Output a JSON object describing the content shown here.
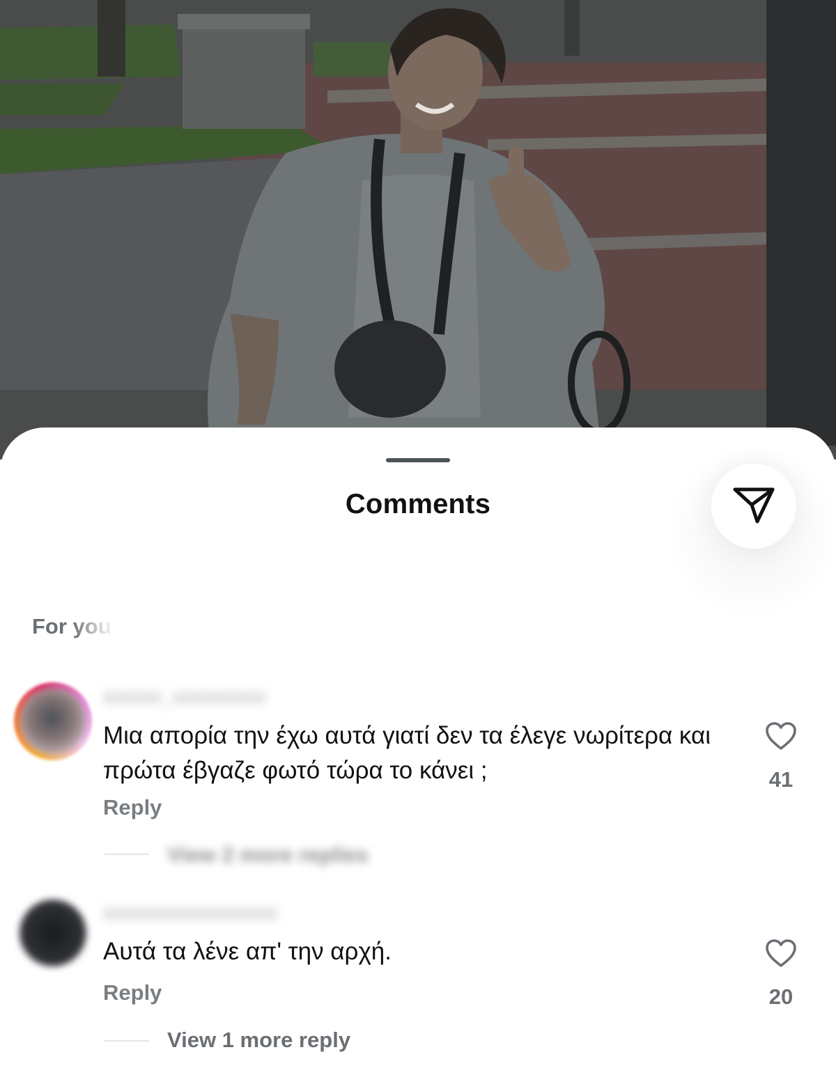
{
  "sheet": {
    "title": "Comments",
    "share_icon": "send-icon",
    "sort_label": "For you"
  },
  "comments": [
    {
      "username": "xxxxx_xxxxxxxx",
      "text": "Μια απορία την έχω αυτά γιατί δεν τα έλεγε νωρίτερα και πρώτα έβγαζε φωτό τώρα το κάνει ;",
      "reply_label": "Reply",
      "likes": "41",
      "view_more": "View 2 more replies"
    },
    {
      "username": "xxxxxxxxxxxxxxx",
      "text": "Αυτά τα λένε απ' την αρχή.",
      "reply_label": "Reply",
      "likes": "20",
      "view_more": "View 1 more reply"
    }
  ],
  "colors": {
    "title": "#111111",
    "secondary_text": "#6b6f73",
    "photo_overlay": "#3f4345"
  }
}
